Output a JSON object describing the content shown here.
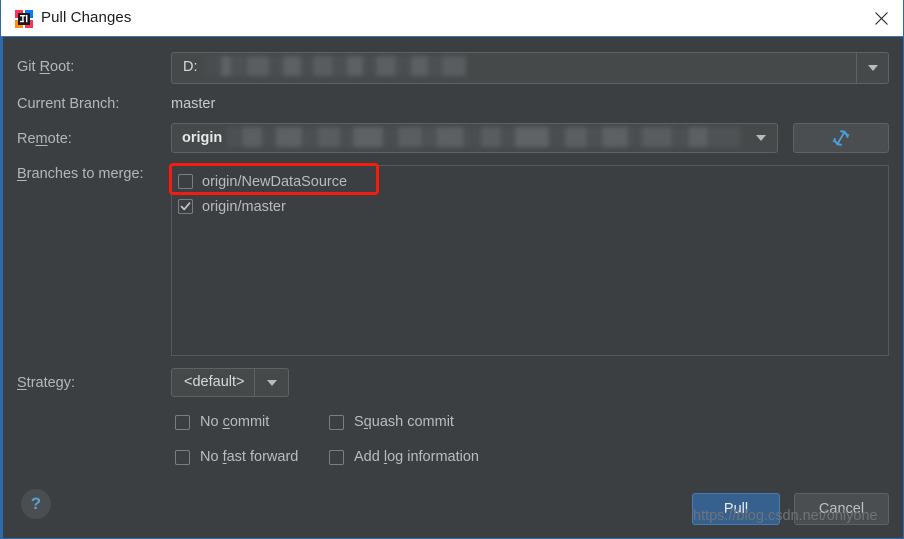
{
  "window": {
    "title": "Pull Changes",
    "app_icon": "intellij-idea-icon",
    "close_icon": "close-icon"
  },
  "form": {
    "git_root": {
      "label_pre": "Git ",
      "label_mnemonic": "R",
      "label_post": "oot:",
      "value": "D:",
      "redacted": true,
      "dropdown_icon": "chevron-down-icon"
    },
    "current_branch": {
      "label": "Current Branch:",
      "value": "master"
    },
    "remote": {
      "label_pre": "Re",
      "label_mnemonic": "m",
      "label_post": "ote:",
      "value": "origin",
      "redacted": true,
      "dropdown_icon": "chevron-down-icon"
    },
    "refresh_button": {
      "icon": "refresh-icon",
      "color": "#4a9fe0"
    },
    "branches_to_merge": {
      "label_pre": "",
      "label_mnemonic": "B",
      "label_post": "ranches to merge:",
      "items": [
        {
          "label": "origin/NewDataSource",
          "checked": false,
          "highlighted": true
        },
        {
          "label": "origin/master",
          "checked": true,
          "highlighted": false
        }
      ]
    },
    "strategy": {
      "label_pre": "",
      "label_mnemonic": "S",
      "label_post": "trategy:",
      "value": "<default>",
      "dropdown_icon": "chevron-down-icon"
    },
    "options": [
      {
        "pre": "No ",
        "mnemonic": "c",
        "post": "ommit",
        "checked": false
      },
      {
        "pre": "S",
        "mnemonic": "q",
        "post": "uash commit",
        "checked": false
      },
      {
        "pre": "No ",
        "mnemonic": "f",
        "post": "ast forward",
        "checked": false
      },
      {
        "pre": "Add ",
        "mnemonic": "l",
        "post": "og information",
        "checked": false
      }
    ]
  },
  "footer": {
    "help_glyph": "?",
    "pull_label": "Pull",
    "cancel_label": "Cancel"
  },
  "watermark": {
    "text": "https://blog.csdn.net/onlyone"
  },
  "colors": {
    "dialog_bg": "#3c3f41",
    "titlebar_bg": "#ffffff",
    "accent_blue": "#2f6aaa",
    "primary_button": "#36618e",
    "highlight_red": "#f41b11",
    "icon_blue": "#4a9fe0",
    "text": "#b9bcbe"
  }
}
